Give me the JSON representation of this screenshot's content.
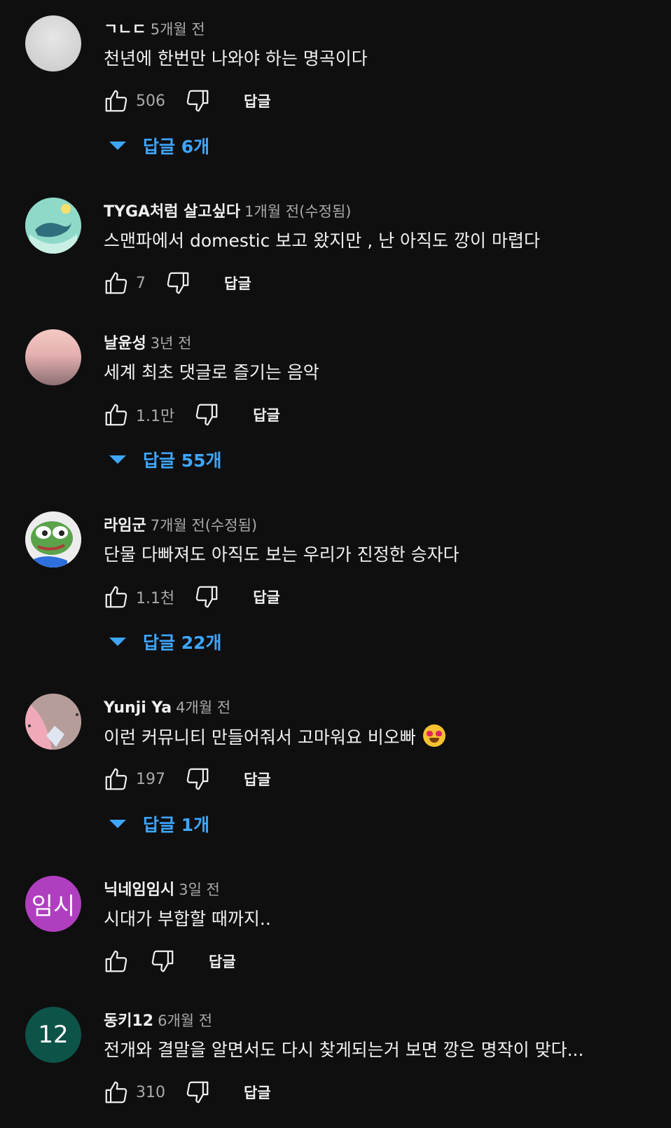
{
  "comments": [
    {
      "author": "ㄱㄴㄷ",
      "time": "5개월 전",
      "text": "천년에 한번만 나와야 하는 명곡이다",
      "likes": "506",
      "reply_label": "답글",
      "replies_label": "답글 6개",
      "avatar": {
        "type": "image",
        "color": "#d9d9d9"
      }
    },
    {
      "author": "TYGA처럼 살고싶다",
      "time": "1개월 전(수정됨)",
      "text": "스맨파에서 domestic 보고 왔지만 , 난 아직도 깡이 마렵다",
      "likes": "7",
      "reply_label": "답글",
      "avatar": {
        "type": "image",
        "color": "#62c3b5"
      }
    },
    {
      "author": "날윤성",
      "time": "3년 전",
      "text": "세계 최초 댓글로 즐기는 음악",
      "likes": "1.1만",
      "reply_label": "답글",
      "replies_label": "답글 55개",
      "avatar": {
        "type": "image",
        "color": "#d8a6a8"
      }
    },
    {
      "author": "라임군",
      "time": "7개월 전(수정됨)",
      "text": "단물 다빠져도 아직도 보는 우리가 진정한 승자다",
      "likes": "1.1천",
      "reply_label": "답글",
      "replies_label": "답글 22개",
      "avatar": {
        "type": "image",
        "color": "#4a8a3a"
      }
    },
    {
      "author": "Yunji Ya",
      "time": "4개월 전",
      "text": "이런 커뮤니티 만들어줘서 고마워요 비오빠",
      "emoji": "smiling-face-with-heart-eyes",
      "likes": "197",
      "reply_label": "답글",
      "replies_label": "답글 1개",
      "avatar": {
        "type": "image",
        "color": "#a98f8f"
      }
    },
    {
      "author": "닉네임임시",
      "time": "3일 전",
      "text": "시대가 부합할 때까지..",
      "likes": "",
      "reply_label": "답글",
      "avatar": {
        "type": "letters",
        "letters": "임시",
        "color": "#b03fc0"
      }
    },
    {
      "author": "동키12",
      "time": "6개월 전",
      "text": "전개와 결말을 알면서도 다시 찾게되는거 보면 깡은 명작이 맞다...",
      "likes": "310",
      "reply_label": "답글",
      "avatar": {
        "type": "letters",
        "letters": "12",
        "color": "#0d5448"
      }
    }
  ]
}
